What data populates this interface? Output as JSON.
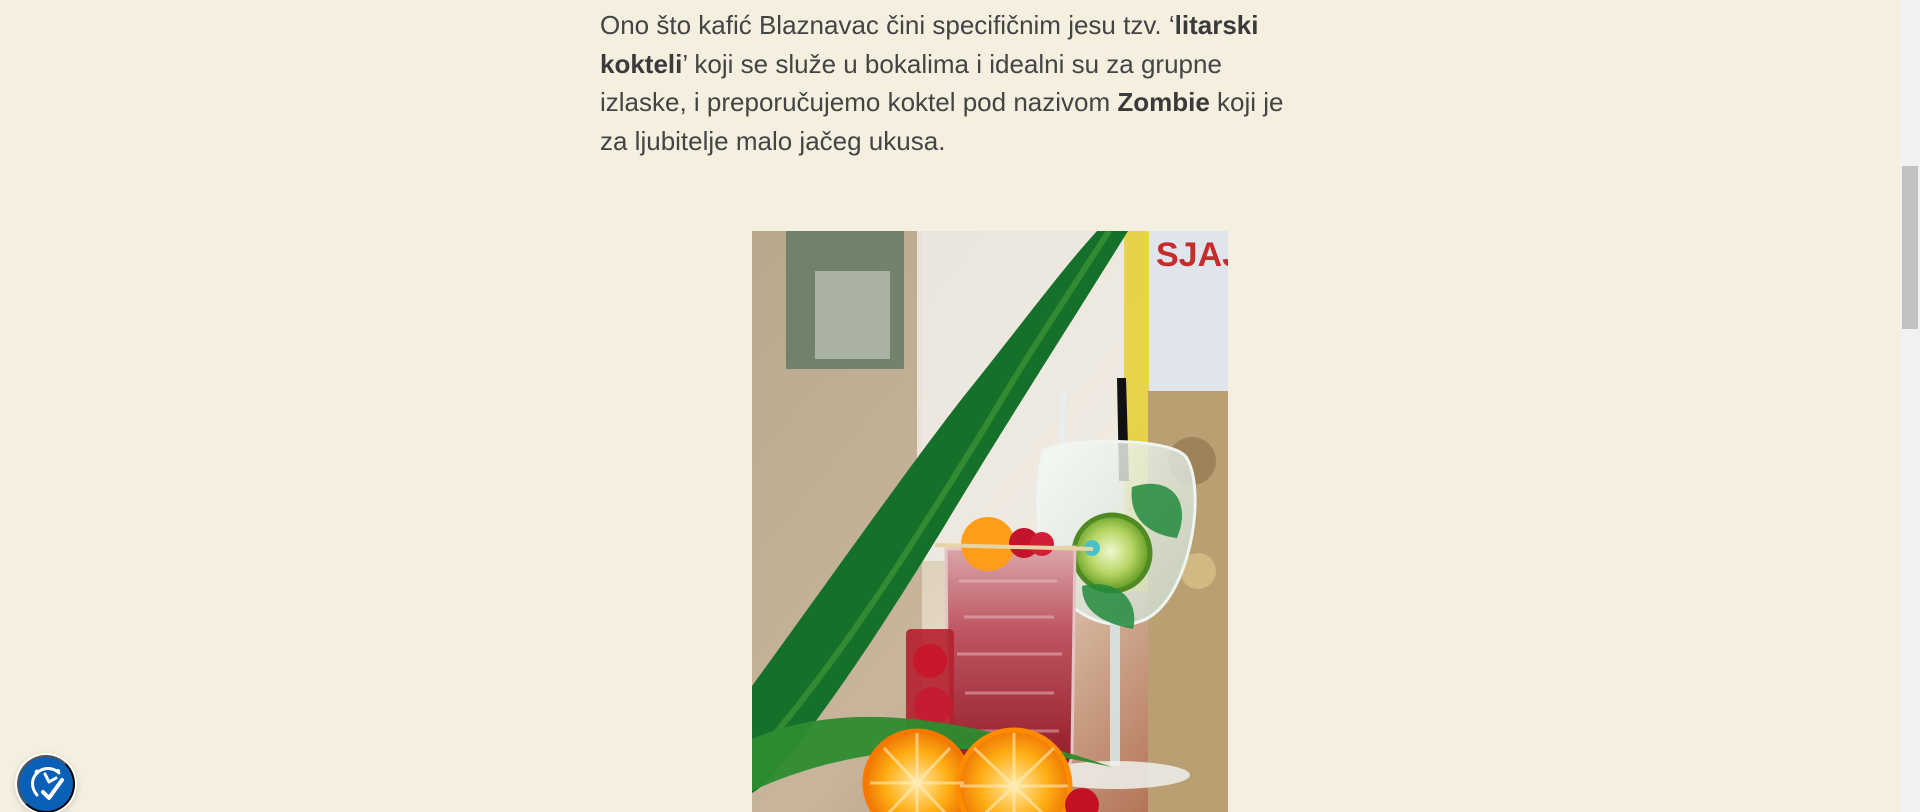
{
  "article": {
    "paragraph": {
      "part1": "Ono što kafić Blaznavac čini specifičnim jesu tzv. ‘",
      "bold1": "litarski kokteli",
      "part2": "’ koji se služe u bokalima i idealni su za grupne izlaske, i preporučujemo koktel pod nazivom ",
      "bold2": "Zombie",
      "part3": " koji je za ljubitelje malo jačeg ukusa."
    },
    "photo": {
      "subject": "cocktails",
      "sign_text": "SJAJ"
    }
  },
  "ui": {
    "accessibility_icon": "accessibility-icon",
    "accent": "#0a5fb6",
    "background": "#f5efe0"
  }
}
